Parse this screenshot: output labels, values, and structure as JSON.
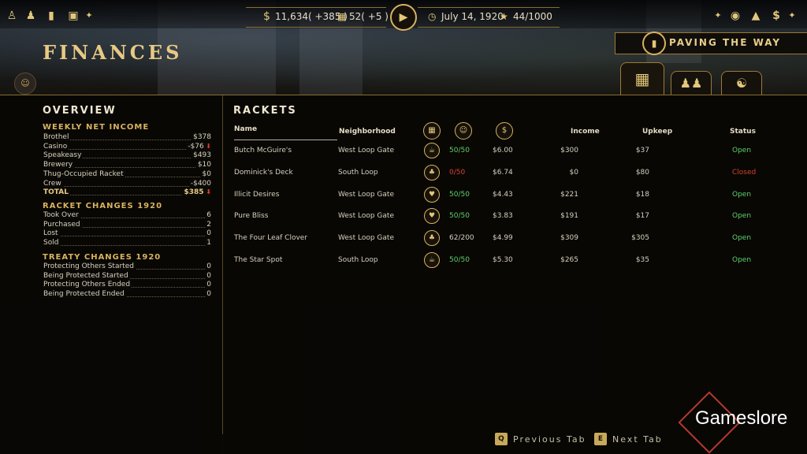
{
  "topbar": {
    "left_icons": [
      "gangsters-icon",
      "crew-icon",
      "ledger-icon",
      "briefcase-icon"
    ],
    "money": "11,634",
    "money_delta": "( +385 )",
    "bank": "52",
    "bank_delta": "( +5 )",
    "date": "July 14, 1920",
    "heat": "44/1000",
    "right_icons": [
      "mask-icon",
      "building-icon",
      "dollar-icon"
    ]
  },
  "header": {
    "title": "FINANCES",
    "mission": "PAVING THE WAY"
  },
  "overview": {
    "heading": "OVERVIEW",
    "weekly_net_income": {
      "heading": "WEEKLY NET INCOME",
      "rows": [
        {
          "label": "Brothel",
          "value": "$378",
          "trend": ""
        },
        {
          "label": "Casino",
          "value": "-$76",
          "trend": "down"
        },
        {
          "label": "Speakeasy",
          "value": "$493",
          "trend": ""
        },
        {
          "label": "Brewery",
          "value": "$10",
          "trend": ""
        },
        {
          "label": "Thug-Occupied Racket",
          "value": "$0",
          "trend": ""
        },
        {
          "label": "Crew",
          "value": "-$400",
          "trend": ""
        }
      ],
      "total_label": "TOTAL",
      "total_value": "$385",
      "total_trend": "down"
    },
    "racket_changes": {
      "heading": "RACKET CHANGES 1920",
      "rows": [
        {
          "label": "Took Over",
          "value": "6"
        },
        {
          "label": "Purchased",
          "value": "2"
        },
        {
          "label": "Lost",
          "value": "0"
        },
        {
          "label": "Sold",
          "value": "1"
        }
      ]
    },
    "treaty_changes": {
      "heading": "TREATY CHANGES 1920",
      "rows": [
        {
          "label": "Protecting Others Started",
          "value": "0"
        },
        {
          "label": "Being Protected Started",
          "value": "0"
        },
        {
          "label": "Protecting Others Ended",
          "value": "0"
        },
        {
          "label": "Being Protected Ended",
          "value": "0"
        }
      ]
    }
  },
  "rackets": {
    "heading": "RACKETS",
    "columns": {
      "name": "Name",
      "neighborhood": "Neighborhood",
      "income": "Income",
      "upkeep": "Upkeep",
      "status": "Status"
    },
    "rows": [
      {
        "name": "Butch McGuire's",
        "neighborhood": "West Loop Gate",
        "type_icon": "speakeasy-icon",
        "capacity": "50/50",
        "capacity_color": "green",
        "price": "$6.00",
        "income": "$300",
        "upkeep": "$37",
        "status": "Open",
        "status_color": "green"
      },
      {
        "name": "Dominick's Deck",
        "neighborhood": "South Loop",
        "type_icon": "casino-icon",
        "capacity": "0/50",
        "capacity_color": "red",
        "price": "$6.74",
        "income": "$0",
        "upkeep": "$80",
        "status": "Closed",
        "status_color": "red"
      },
      {
        "name": "Illicit Desires",
        "neighborhood": "West Loop Gate",
        "type_icon": "brothel-icon",
        "capacity": "50/50",
        "capacity_color": "green",
        "price": "$4.43",
        "income": "$221",
        "upkeep": "$18",
        "status": "Open",
        "status_color": "green"
      },
      {
        "name": "Pure Bliss",
        "neighborhood": "West Loop Gate",
        "type_icon": "brothel-icon",
        "capacity": "50/50",
        "capacity_color": "green",
        "price": "$3.83",
        "income": "$191",
        "upkeep": "$17",
        "status": "Open",
        "status_color": "green"
      },
      {
        "name": "The Four Leaf Clover",
        "neighborhood": "West Loop Gate",
        "type_icon": "casino-icon",
        "capacity": "62/200",
        "capacity_color": "plain",
        "price": "$4.99",
        "income": "$309",
        "upkeep": "$305",
        "status": "Open",
        "status_color": "green"
      },
      {
        "name": "The Star Spot",
        "neighborhood": "South Loop",
        "type_icon": "speakeasy-icon",
        "capacity": "50/50",
        "capacity_color": "green",
        "price": "$5.30",
        "income": "$265",
        "upkeep": "$35",
        "status": "Open",
        "status_color": "green"
      }
    ]
  },
  "footer": {
    "prev_key": "Q",
    "prev_label": "Previous Tab",
    "next_key": "E",
    "next_label": "Next Tab"
  },
  "watermark": "Gameslore",
  "colors": {
    "gold": "#d9b25f",
    "open": "#5fd06a",
    "closed": "#d9402d"
  }
}
